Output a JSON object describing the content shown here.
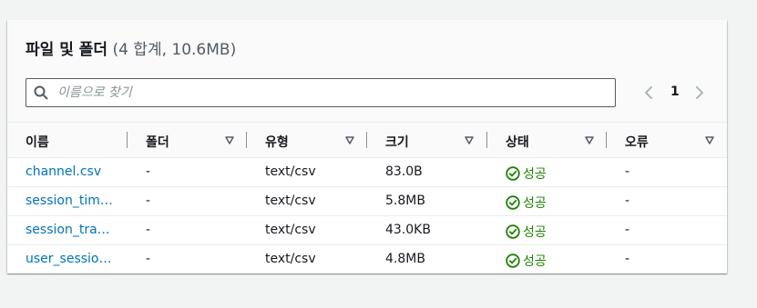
{
  "panel": {
    "title": "파일 및 폴더",
    "counter": "(4 합계, 10.6MB)"
  },
  "search": {
    "placeholder": "이름으로 찾기"
  },
  "pagination": {
    "current_page": "1"
  },
  "table": {
    "columns": [
      "이름",
      "폴더",
      "유형",
      "크기",
      "상태",
      "오류"
    ],
    "rows": [
      {
        "name": "channel.csv",
        "folder": "-",
        "type": "text/csv",
        "size": "83.0B",
        "status": "성공",
        "error": "-"
      },
      {
        "name": "session_tim…",
        "folder": "-",
        "type": "text/csv",
        "size": "5.8MB",
        "status": "성공",
        "error": "-"
      },
      {
        "name": "session_tra…",
        "folder": "-",
        "type": "text/csv",
        "size": "43.0KB",
        "status": "성공",
        "error": "-"
      },
      {
        "name": "user_sessio…",
        "folder": "-",
        "type": "text/csv",
        "size": "4.8MB",
        "status": "성공",
        "error": "-"
      }
    ]
  },
  "colors": {
    "link": "#0073bb",
    "success": "#1d8102",
    "header_bg": "#fafafa",
    "page_bg": "#f2f3f3"
  },
  "icons": {
    "search": "search-icon",
    "prev": "chevron-left-icon",
    "next": "chevron-right-icon",
    "sort": "caret-down-icon",
    "status": "check-circle-icon"
  }
}
